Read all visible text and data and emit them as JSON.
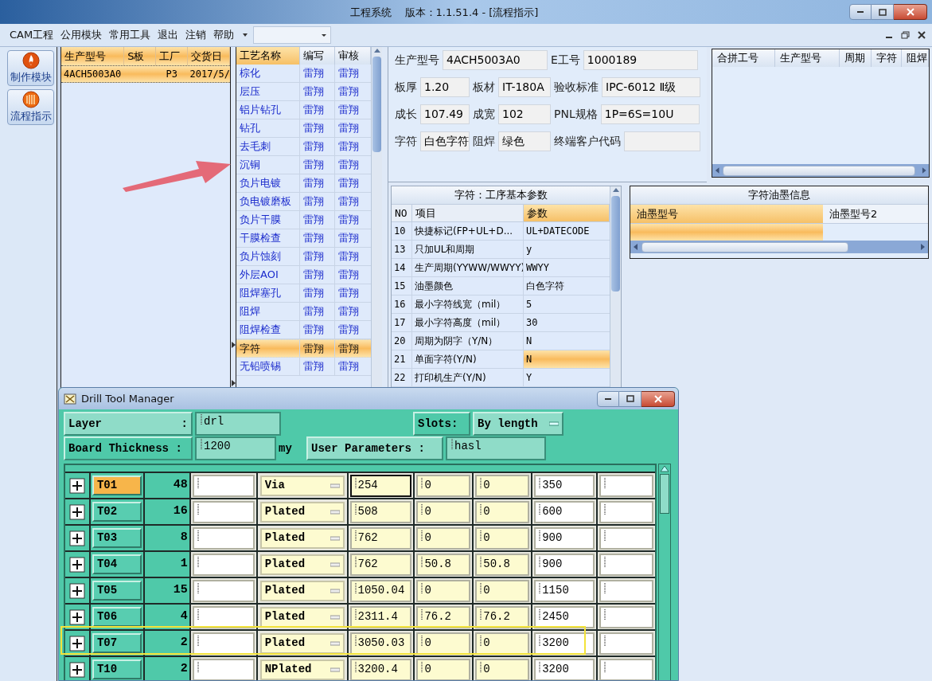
{
  "window": {
    "title": "工程系统    版本：1.1.51.4 - [流程指示]"
  },
  "menu": [
    "CAM工程",
    "公用模块",
    "常用工具",
    "退出",
    "注销",
    "帮助"
  ],
  "toolbar": [
    {
      "label": "制作模块",
      "kind": "flame"
    },
    {
      "label": "流程指示",
      "kind": "grid"
    }
  ],
  "orders": {
    "columns": [
      "生产型号",
      "S板",
      "工厂",
      "交货日"
    ],
    "rows": [
      {
        "cells": [
          "4ACH5003A0",
          "",
          "P3",
          "2017/5/"
        ],
        "selected": true
      }
    ]
  },
  "processes": {
    "columns": [
      "工艺名称",
      "编写",
      "审核"
    ],
    "rows": [
      {
        "name": "棕化",
        "writer": "雷翔",
        "reviewer": "雷翔",
        "selected": false
      },
      {
        "name": "层压",
        "writer": "雷翔",
        "reviewer": "雷翔",
        "selected": false
      },
      {
        "name": "铝片钻孔",
        "writer": "雷翔",
        "reviewer": "雷翔",
        "selected": false
      },
      {
        "name": "钻孔",
        "writer": "雷翔",
        "reviewer": "雷翔",
        "selected": false
      },
      {
        "name": "去毛刺",
        "writer": "雷翔",
        "reviewer": "雷翔",
        "selected": false
      },
      {
        "name": "沉铜",
        "writer": "雷翔",
        "reviewer": "雷翔",
        "selected": false
      },
      {
        "name": "负片电镀",
        "writer": "雷翔",
        "reviewer": "雷翔",
        "selected": false
      },
      {
        "name": "负电镀磨板",
        "writer": "雷翔",
        "reviewer": "雷翔",
        "selected": false
      },
      {
        "name": "负片干膜",
        "writer": "雷翔",
        "reviewer": "雷翔",
        "selected": false
      },
      {
        "name": "干膜检查",
        "writer": "雷翔",
        "reviewer": "雷翔",
        "selected": false
      },
      {
        "name": "负片蚀刻",
        "writer": "雷翔",
        "reviewer": "雷翔",
        "selected": false
      },
      {
        "name": "外层AOI",
        "writer": "雷翔",
        "reviewer": "雷翔",
        "selected": false
      },
      {
        "name": "阻焊塞孔",
        "writer": "雷翔",
        "reviewer": "雷翔",
        "selected": false
      },
      {
        "name": "阻焊",
        "writer": "雷翔",
        "reviewer": "雷翔",
        "selected": false
      },
      {
        "name": "阻焊检查",
        "writer": "雷翔",
        "reviewer": "雷翔",
        "selected": false
      },
      {
        "name": "字符",
        "writer": "雷翔",
        "reviewer": "雷翔",
        "selected": true
      },
      {
        "name": "无铅喷锡",
        "writer": "雷翔",
        "reviewer": "雷翔",
        "selected": false
      }
    ]
  },
  "info": {
    "top": [
      {
        "label": "生产型号",
        "value": "4ACH5003A0"
      },
      {
        "label": "E工号",
        "value": "1000189"
      }
    ],
    "rows": [
      [
        {
          "label": "板厚",
          "value": "1.20"
        },
        {
          "label": "板材",
          "value": "IT-180A"
        },
        {
          "label": "验收标准",
          "value": "IPC-6012 Ⅱ级"
        }
      ],
      [
        {
          "label": "成长",
          "value": "107.49"
        },
        {
          "label": "成宽",
          "value": "102"
        },
        {
          "label": "PNL规格",
          "value": "1P=6S=10U"
        }
      ],
      [
        {
          "label": "字符",
          "value": "白色字符"
        },
        {
          "label": "阻焊",
          "value": "绿色"
        },
        {
          "label": "终端客户代码"
        }
      ]
    ]
  },
  "merge_grid": {
    "columns": [
      "合拼工号",
      "生产型号",
      "周期",
      "字符",
      "阻焊"
    ]
  },
  "params": {
    "title": "字符：工序基本参数",
    "columns": [
      "NO",
      "项目",
      "参数"
    ],
    "rows": [
      {
        "no": "10",
        "item": "快捷标记(FP+UL+D...",
        "value": "UL+DATECODE",
        "selected": false
      },
      {
        "no": "13",
        "item": "只加UL和周期",
        "value": "y",
        "selected": false
      },
      {
        "no": "14",
        "item": "生产周期(YYWW/WWYY)",
        "value": "WWYY",
        "selected": false
      },
      {
        "no": "15",
        "item": "油墨颜色",
        "value": "白色字符",
        "selected": false
      },
      {
        "no": "16",
        "item": "最小字符线宽（mil）",
        "value": "5",
        "selected": false
      },
      {
        "no": "17",
        "item": "最小字符高度（mil）",
        "value": "30",
        "selected": false
      },
      {
        "no": "20",
        "item": "周期为阴字（Y/N）",
        "value": "N",
        "selected": false
      },
      {
        "no": "21",
        "item": "单面字符(Y/N)",
        "value": "N",
        "selected": true
      },
      {
        "no": "22",
        "item": "打印机生产(Y/N)",
        "value": "Y",
        "selected": false
      }
    ]
  },
  "ink": {
    "title": "字符油墨信息",
    "columns": [
      "油墨型号",
      "油墨型号2"
    ],
    "rows": [
      {
        "selected": true
      }
    ]
  },
  "drill": {
    "title": "Drill Tool Manager",
    "layer_label": "Layer",
    "layer_colon": ":",
    "layer": "drl",
    "slots_label": "Slots:",
    "slots": "By length",
    "thickness_label": "Board Thickness :",
    "thickness": "1200",
    "unit": "my",
    "user_params_label": "User Parameters :",
    "user_params": "hasl",
    "rows": [
      {
        "tool": "T01",
        "count": "48",
        "type": "Via",
        "size": "254",
        "plus": "0",
        "minus": "0",
        "drill": "350",
        "selected": true,
        "focused": true,
        "outlined": false
      },
      {
        "tool": "T02",
        "count": "16",
        "type": "Plated",
        "size": "508",
        "plus": "0",
        "minus": "0",
        "drill": "600",
        "selected": false,
        "focused": false,
        "outlined": false
      },
      {
        "tool": "T03",
        "count": "8",
        "type": "Plated",
        "size": "762",
        "plus": "0",
        "minus": "0",
        "drill": "900",
        "selected": false,
        "focused": false,
        "outlined": false
      },
      {
        "tool": "T04",
        "count": "1",
        "type": "Plated",
        "size": "762",
        "plus": "50.8",
        "minus": "50.8",
        "drill": "900",
        "selected": false,
        "focused": false,
        "outlined": false
      },
      {
        "tool": "T05",
        "count": "15",
        "type": "Plated",
        "size": "1050.04",
        "plus": "0",
        "minus": "0",
        "drill": "1150",
        "selected": false,
        "focused": false,
        "outlined": false
      },
      {
        "tool": "T06",
        "count": "4",
        "type": "Plated",
        "size": "2311.4",
        "plus": "76.2",
        "minus": "76.2",
        "drill": "2450",
        "selected": false,
        "focused": false,
        "outlined": false
      },
      {
        "tool": "T07",
        "count": "2",
        "type": "Plated",
        "size": "3050.03",
        "plus": "0",
        "minus": "0",
        "drill": "3200",
        "selected": false,
        "focused": false,
        "outlined": true
      },
      {
        "tool": "T10",
        "count": "2",
        "type": "NPlated",
        "size": "3200.4",
        "plus": "0",
        "minus": "0",
        "drill": "3200",
        "selected": false,
        "focused": false,
        "outlined": false
      }
    ]
  }
}
